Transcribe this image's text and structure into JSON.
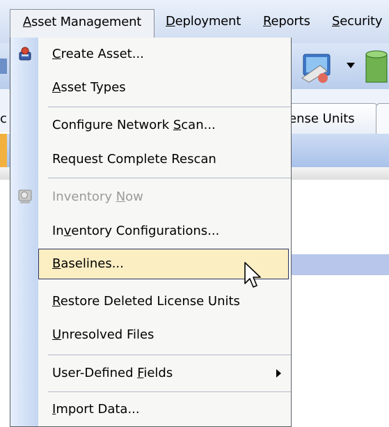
{
  "menubar": {
    "items": [
      {
        "pre": "",
        "u": "A",
        "post": "sset Management"
      },
      {
        "pre": "",
        "u": "D",
        "post": "eployment"
      },
      {
        "pre": "",
        "u": "R",
        "post": "eports"
      },
      {
        "pre": "",
        "u": "S",
        "post": "ecurity"
      }
    ]
  },
  "background": {
    "tab_label": "ense Units",
    "left_clip_letter": "c"
  },
  "menu": {
    "items": [
      {
        "pre": "",
        "u": "C",
        "post": "reate Asset...",
        "icon": "create-asset-icon"
      },
      {
        "pre": "",
        "u": "A",
        "post": "sset Types"
      },
      {
        "pre": "Configure Network ",
        "u": "S",
        "post": "can..."
      },
      {
        "pre": "Request Complete Rescan",
        "u": "",
        "post": ""
      },
      {
        "pre": "Inventory ",
        "u": "N",
        "post": "ow",
        "disabled": true,
        "icon": "inventory-now-icon"
      },
      {
        "pre": "In",
        "u": "v",
        "post": "entory Configurations..."
      },
      {
        "pre": "",
        "u": "B",
        "post": "aselines...",
        "highlighted": true
      },
      {
        "pre": "",
        "u": "R",
        "post": "estore Deleted License Units"
      },
      {
        "pre": "",
        "u": "U",
        "post": "nresolved Files"
      },
      {
        "pre": "User-Defined ",
        "u": "F",
        "post": "ields",
        "submenu": true
      },
      {
        "pre": "",
        "u": "I",
        "post": "mport Data..."
      }
    ]
  },
  "colors": {
    "highlight_fill": "#fbeec3",
    "highlight_border": "#2c3560",
    "disabled_text": "#9a9a9a"
  }
}
